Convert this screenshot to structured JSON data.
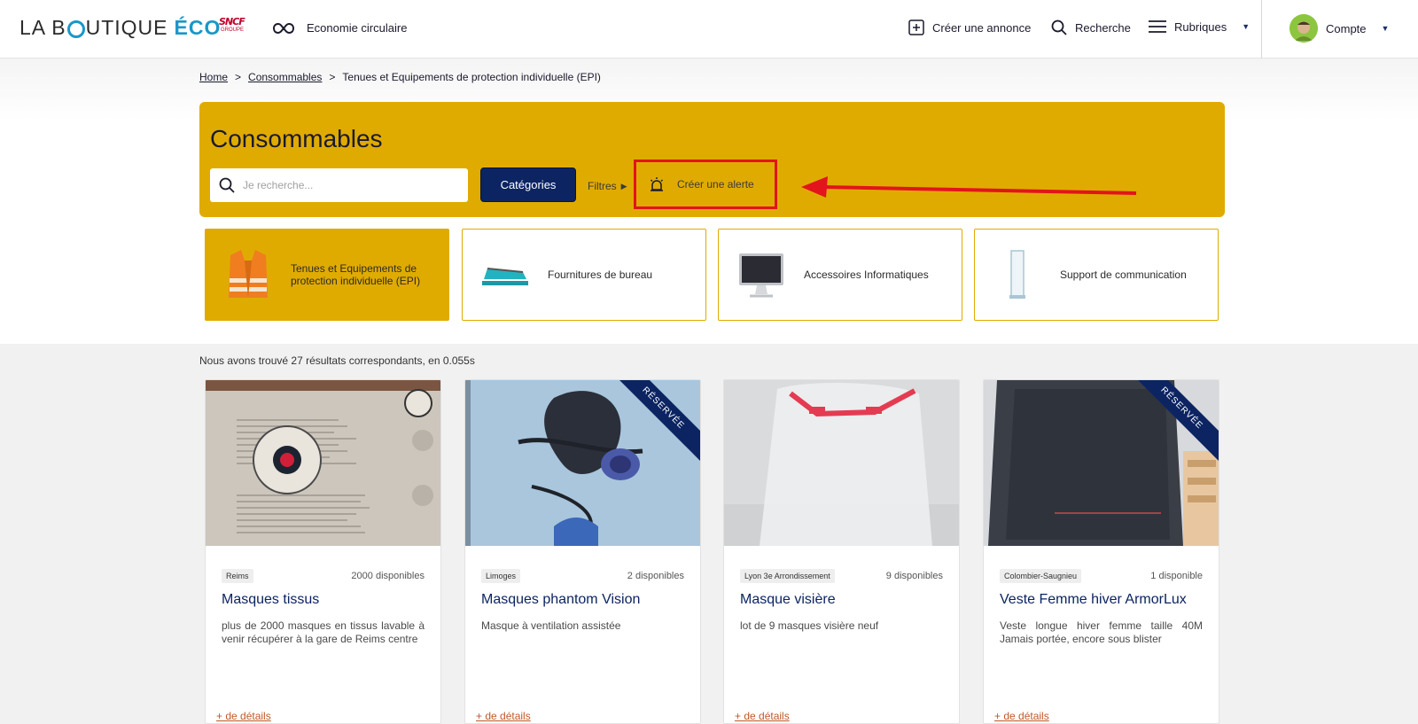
{
  "header": {
    "logo_prefix": "LA B",
    "logo_suffix": "UTIQUE",
    "logo_eco": "ÉCO",
    "sncf_brand": "SNCF",
    "sncf_group": "GROUPE",
    "circular_label": "Economie circulaire",
    "create_label": "Créer une annonce",
    "search_label": "Recherche",
    "rubrics_label": "Rubriques",
    "account_label": "Compte"
  },
  "breadcrumb": {
    "home": "Home",
    "sep1": ">",
    "consommables": "Consommables",
    "sep2": ">",
    "current": "Tenues et Equipements de protection individuelle (EPI)"
  },
  "panel": {
    "title": "Consommables",
    "search_placeholder": "Je recherche...",
    "categories_button": "Catégories",
    "filters_label": "Filtres",
    "filters_arrow": "▶",
    "alert_label": "Créer une alerte"
  },
  "categories": [
    {
      "label": "Tenues et Equipements de protection individuelle (EPI)",
      "icon": "safety-vest-icon"
    },
    {
      "label": "Fournitures de bureau",
      "icon": "stapler-icon"
    },
    {
      "label": "Accessoires Informatiques",
      "icon": "monitor-icon"
    },
    {
      "label": "Support de communication",
      "icon": "display-panel-icon"
    }
  ],
  "results_text": "Nous avons trouvé 27 résultats correspondants, en 0.055s",
  "products": [
    {
      "location": "Reims",
      "availability": "2000 disponibles",
      "title": "Masques tissus",
      "description": "plus de 2000 masques en tissus lavable à venir récupérer à la gare de Reims centre",
      "details": "+ de détails",
      "ribbon": ""
    },
    {
      "location": "Limoges",
      "availability": "2 disponibles",
      "title": "Masques phantom Vision",
      "description": "Masque à ventilation assistée",
      "details": "+ de détails",
      "ribbon": "RÉSERVÉE"
    },
    {
      "location": "Lyon 3e Arrondissement",
      "availability": "9 disponibles",
      "title": "Masque visière",
      "description": "lot de 9 masques visière neuf",
      "details": "+ de détails",
      "ribbon": ""
    },
    {
      "location": "Colombier-Saugnieu",
      "availability": "1 disponible",
      "title": "Veste Femme hiver ArmorLux",
      "description": "Veste longue hiver femme taille 40M Jamais portée, encore sous blister",
      "details": "+ de détails",
      "ribbon": "RÉSERVÉE"
    }
  ],
  "colors": {
    "accent": "#e0ab00",
    "navy": "#0c2462",
    "highlight": "#e2141c"
  }
}
